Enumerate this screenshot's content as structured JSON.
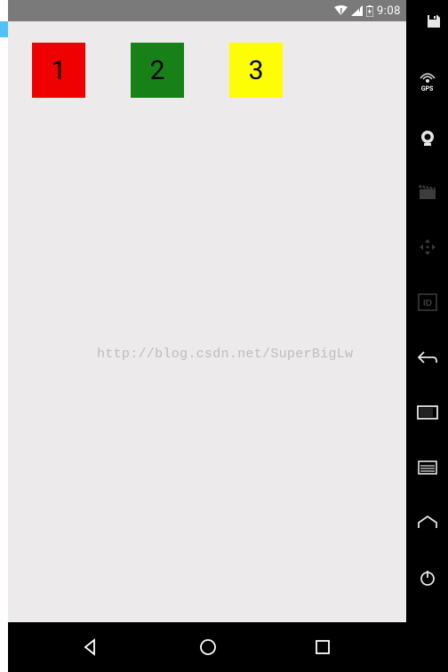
{
  "status": {
    "clock": "9:08"
  },
  "boxes": [
    {
      "label": "1",
      "color": "red"
    },
    {
      "label": "2",
      "color": "green"
    },
    {
      "label": "3",
      "color": "yellow"
    }
  ],
  "watermark": "http://blog.csdn.net/SuperBigLw",
  "side": {
    "gps_label": "GPS"
  }
}
